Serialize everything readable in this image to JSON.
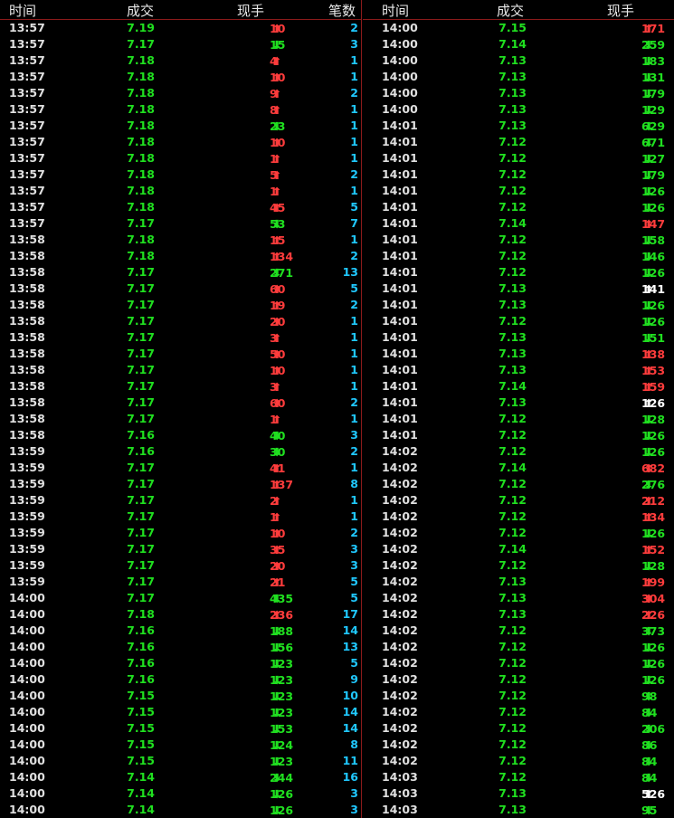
{
  "headers": {
    "left": {
      "time": "时间",
      "price": "成交",
      "volume": "现手",
      "count": "笔数"
    },
    "right": {
      "time": "时间",
      "price": "成交",
      "volume": "现手"
    }
  },
  "colors": {
    "up": "#ff3c3c",
    "down": "#20e020",
    "neutral": "#ffffff",
    "count": "#20c8ff",
    "divider": "#8b1a1a"
  },
  "left_rows": [
    {
      "time": "13:57",
      "price": "7.19",
      "vol": "10",
      "dir": "up",
      "count": "2"
    },
    {
      "time": "13:57",
      "price": "7.17",
      "vol": "15",
      "dir": "down",
      "count": "3"
    },
    {
      "time": "13:57",
      "price": "7.18",
      "vol": "4",
      "dir": "up",
      "count": "1"
    },
    {
      "time": "13:57",
      "price": "7.18",
      "vol": "10",
      "dir": "up",
      "count": "1"
    },
    {
      "time": "13:57",
      "price": "7.18",
      "vol": "9",
      "dir": "up",
      "count": "2"
    },
    {
      "time": "13:57",
      "price": "7.18",
      "vol": "8",
      "dir": "up",
      "count": "1"
    },
    {
      "time": "13:57",
      "price": "7.18",
      "vol": "23",
      "dir": "down",
      "count": "1"
    },
    {
      "time": "13:57",
      "price": "7.18",
      "vol": "10",
      "dir": "up",
      "count": "1"
    },
    {
      "time": "13:57",
      "price": "7.18",
      "vol": "1",
      "dir": "up",
      "count": "1"
    },
    {
      "time": "13:57",
      "price": "7.18",
      "vol": "5",
      "dir": "up",
      "count": "2"
    },
    {
      "time": "13:57",
      "price": "7.18",
      "vol": "1",
      "dir": "up",
      "count": "1"
    },
    {
      "time": "13:57",
      "price": "7.18",
      "vol": "45",
      "dir": "up",
      "count": "5"
    },
    {
      "time": "13:57",
      "price": "7.17",
      "vol": "53",
      "dir": "down",
      "count": "7"
    },
    {
      "time": "13:58",
      "price": "7.18",
      "vol": "15",
      "dir": "up",
      "count": "1"
    },
    {
      "time": "13:58",
      "price": "7.18",
      "vol": "134",
      "dir": "up",
      "count": "2"
    },
    {
      "time": "13:58",
      "price": "7.17",
      "vol": "271",
      "dir": "down",
      "count": "13"
    },
    {
      "time": "13:58",
      "price": "7.17",
      "vol": "60",
      "dir": "up",
      "count": "5"
    },
    {
      "time": "13:58",
      "price": "7.17",
      "vol": "19",
      "dir": "up",
      "count": "2"
    },
    {
      "time": "13:58",
      "price": "7.17",
      "vol": "20",
      "dir": "up",
      "count": "1"
    },
    {
      "time": "13:58",
      "price": "7.17",
      "vol": "3",
      "dir": "up",
      "count": "1"
    },
    {
      "time": "13:58",
      "price": "7.17",
      "vol": "50",
      "dir": "up",
      "count": "1"
    },
    {
      "time": "13:58",
      "price": "7.17",
      "vol": "10",
      "dir": "up",
      "count": "1"
    },
    {
      "time": "13:58",
      "price": "7.17",
      "vol": "3",
      "dir": "up",
      "count": "1"
    },
    {
      "time": "13:58",
      "price": "7.17",
      "vol": "60",
      "dir": "up",
      "count": "2"
    },
    {
      "time": "13:58",
      "price": "7.17",
      "vol": "1",
      "dir": "up",
      "count": "1"
    },
    {
      "time": "13:58",
      "price": "7.16",
      "vol": "40",
      "dir": "down",
      "count": "3"
    },
    {
      "time": "13:59",
      "price": "7.16",
      "vol": "30",
      "dir": "down",
      "count": "2"
    },
    {
      "time": "13:59",
      "price": "7.17",
      "vol": "41",
      "dir": "up",
      "count": "1"
    },
    {
      "time": "13:59",
      "price": "7.17",
      "vol": "137",
      "dir": "up",
      "count": "8"
    },
    {
      "time": "13:59",
      "price": "7.17",
      "vol": "2",
      "dir": "up",
      "count": "1"
    },
    {
      "time": "13:59",
      "price": "7.17",
      "vol": "1",
      "dir": "up",
      "count": "1"
    },
    {
      "time": "13:59",
      "price": "7.17",
      "vol": "10",
      "dir": "up",
      "count": "2"
    },
    {
      "time": "13:59",
      "price": "7.17",
      "vol": "35",
      "dir": "up",
      "count": "3"
    },
    {
      "time": "13:59",
      "price": "7.17",
      "vol": "20",
      "dir": "up",
      "count": "3"
    },
    {
      "time": "13:59",
      "price": "7.17",
      "vol": "21",
      "dir": "up",
      "count": "5"
    },
    {
      "time": "14:00",
      "price": "7.17",
      "vol": "435",
      "dir": "down",
      "count": "5"
    },
    {
      "time": "14:00",
      "price": "7.18",
      "vol": "236",
      "dir": "up",
      "count": "17"
    },
    {
      "time": "14:00",
      "price": "7.16",
      "vol": "188",
      "dir": "down",
      "count": "14"
    },
    {
      "time": "14:00",
      "price": "7.16",
      "vol": "156",
      "dir": "down",
      "count": "13"
    },
    {
      "time": "14:00",
      "price": "7.16",
      "vol": "123",
      "dir": "down",
      "count": "5"
    },
    {
      "time": "14:00",
      "price": "7.16",
      "vol": "123",
      "dir": "down",
      "count": "9"
    },
    {
      "time": "14:00",
      "price": "7.15",
      "vol": "123",
      "dir": "down",
      "count": "10"
    },
    {
      "time": "14:00",
      "price": "7.15",
      "vol": "123",
      "dir": "down",
      "count": "14"
    },
    {
      "time": "14:00",
      "price": "7.15",
      "vol": "153",
      "dir": "down",
      "count": "14"
    },
    {
      "time": "14:00",
      "price": "7.15",
      "vol": "124",
      "dir": "down",
      "count": "8"
    },
    {
      "time": "14:00",
      "price": "7.15",
      "vol": "123",
      "dir": "down",
      "count": "11"
    },
    {
      "time": "14:00",
      "price": "7.14",
      "vol": "244",
      "dir": "down",
      "count": "16"
    },
    {
      "time": "14:00",
      "price": "7.14",
      "vol": "126",
      "dir": "down",
      "count": "3"
    },
    {
      "time": "14:00",
      "price": "7.14",
      "vol": "126",
      "dir": "down",
      "count": "3"
    }
  ],
  "right_rows": [
    {
      "time": "14:00",
      "price": "7.15",
      "vol": "171",
      "dir": "up"
    },
    {
      "time": "14:00",
      "price": "7.14",
      "vol": "259",
      "dir": "down"
    },
    {
      "time": "14:00",
      "price": "7.13",
      "vol": "183",
      "dir": "down"
    },
    {
      "time": "14:00",
      "price": "7.13",
      "vol": "131",
      "dir": "down"
    },
    {
      "time": "14:00",
      "price": "7.13",
      "vol": "179",
      "dir": "down"
    },
    {
      "time": "14:00",
      "price": "7.13",
      "vol": "129",
      "dir": "down"
    },
    {
      "time": "14:01",
      "price": "7.13",
      "vol": "629",
      "dir": "down"
    },
    {
      "time": "14:01",
      "price": "7.12",
      "vol": "671",
      "dir": "down"
    },
    {
      "time": "14:01",
      "price": "7.12",
      "vol": "127",
      "dir": "down"
    },
    {
      "time": "14:01",
      "price": "7.12",
      "vol": "179",
      "dir": "down"
    },
    {
      "time": "14:01",
      "price": "7.12",
      "vol": "126",
      "dir": "down"
    },
    {
      "time": "14:01",
      "price": "7.12",
      "vol": "126",
      "dir": "down"
    },
    {
      "time": "14:01",
      "price": "7.14",
      "vol": "147",
      "dir": "up"
    },
    {
      "time": "14:01",
      "price": "7.12",
      "vol": "158",
      "dir": "down"
    },
    {
      "time": "14:01",
      "price": "7.12",
      "vol": "146",
      "dir": "down"
    },
    {
      "time": "14:01",
      "price": "7.12",
      "vol": "126",
      "dir": "down"
    },
    {
      "time": "14:01",
      "price": "7.13",
      "vol": "141",
      "dir": "neutral"
    },
    {
      "time": "14:01",
      "price": "7.13",
      "vol": "126",
      "dir": "down"
    },
    {
      "time": "14:01",
      "price": "7.12",
      "vol": "126",
      "dir": "down"
    },
    {
      "time": "14:01",
      "price": "7.13",
      "vol": "151",
      "dir": "down"
    },
    {
      "time": "14:01",
      "price": "7.13",
      "vol": "138",
      "dir": "up"
    },
    {
      "time": "14:01",
      "price": "7.13",
      "vol": "153",
      "dir": "up"
    },
    {
      "time": "14:01",
      "price": "7.14",
      "vol": "159",
      "dir": "up"
    },
    {
      "time": "14:01",
      "price": "7.13",
      "vol": "126",
      "dir": "neutral"
    },
    {
      "time": "14:01",
      "price": "7.12",
      "vol": "128",
      "dir": "down"
    },
    {
      "time": "14:01",
      "price": "7.12",
      "vol": "126",
      "dir": "down"
    },
    {
      "time": "14:02",
      "price": "7.12",
      "vol": "126",
      "dir": "down"
    },
    {
      "time": "14:02",
      "price": "7.14",
      "vol": "682",
      "dir": "up"
    },
    {
      "time": "14:02",
      "price": "7.12",
      "vol": "276",
      "dir": "down"
    },
    {
      "time": "14:02",
      "price": "7.12",
      "vol": "212",
      "dir": "up"
    },
    {
      "time": "14:02",
      "price": "7.12",
      "vol": "134",
      "dir": "up"
    },
    {
      "time": "14:02",
      "price": "7.12",
      "vol": "126",
      "dir": "down"
    },
    {
      "time": "14:02",
      "price": "7.14",
      "vol": "152",
      "dir": "up"
    },
    {
      "time": "14:02",
      "price": "7.12",
      "vol": "128",
      "dir": "down"
    },
    {
      "time": "14:02",
      "price": "7.13",
      "vol": "199",
      "dir": "up"
    },
    {
      "time": "14:02",
      "price": "7.13",
      "vol": "304",
      "dir": "up"
    },
    {
      "time": "14:02",
      "price": "7.13",
      "vol": "226",
      "dir": "up"
    },
    {
      "time": "14:02",
      "price": "7.12",
      "vol": "373",
      "dir": "down"
    },
    {
      "time": "14:02",
      "price": "7.12",
      "vol": "126",
      "dir": "down"
    },
    {
      "time": "14:02",
      "price": "7.12",
      "vol": "126",
      "dir": "down"
    },
    {
      "time": "14:02",
      "price": "7.12",
      "vol": "126",
      "dir": "down"
    },
    {
      "time": "14:02",
      "price": "7.12",
      "vol": "98",
      "dir": "down"
    },
    {
      "time": "14:02",
      "price": "7.12",
      "vol": "84",
      "dir": "down"
    },
    {
      "time": "14:02",
      "price": "7.12",
      "vol": "206",
      "dir": "down"
    },
    {
      "time": "14:02",
      "price": "7.12",
      "vol": "86",
      "dir": "down"
    },
    {
      "time": "14:02",
      "price": "7.12",
      "vol": "84",
      "dir": "down"
    },
    {
      "time": "14:03",
      "price": "7.12",
      "vol": "84",
      "dir": "down"
    },
    {
      "time": "14:03",
      "price": "7.13",
      "vol": "526",
      "dir": "neutral"
    },
    {
      "time": "14:03",
      "price": "7.13",
      "vol": "95",
      "dir": "down"
    }
  ]
}
